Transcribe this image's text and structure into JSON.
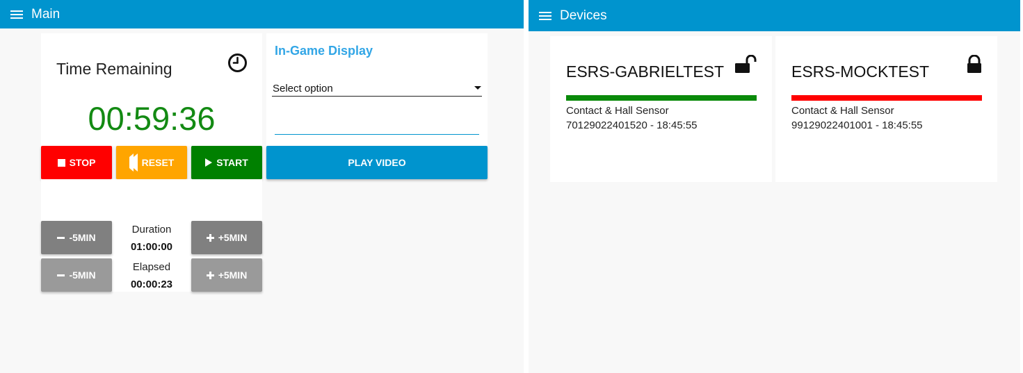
{
  "main": {
    "title": "Main",
    "time_card": {
      "title": "Time Remaining",
      "value": "00:59:36"
    },
    "display_card": {
      "title": "In-Game Display",
      "select_value": "Select option",
      "input_value": ""
    },
    "buttons": {
      "stop": "STOP",
      "reset": "RESET",
      "start": "START",
      "play_video": "PLAY VIDEO",
      "duration_minus": "-5MIN",
      "duration_plus": "+5MIN",
      "elapsed_minus": "-5MIN",
      "elapsed_plus": "+5MIN"
    },
    "duration": {
      "label": "Duration",
      "value": "01:00:00"
    },
    "elapsed": {
      "label": "Elapsed",
      "value": "00:00:23"
    }
  },
  "devices": {
    "title": "Devices",
    "items": [
      {
        "name": "ESRS-GABRIELTEST",
        "sensor": "Contact & Hall Sensor",
        "id_time": "70129022401520 - 18:45:55",
        "status_color": "#0a8a0a",
        "lock_icon": "lock-open-icon"
      },
      {
        "name": "ESRS-MOCKTEST",
        "sensor": "Contact & Hall Sensor",
        "id_time": "99129022401001 - 18:45:55",
        "status_color": "#ff0000",
        "lock_icon": "lock-closed-icon"
      }
    ]
  },
  "colors": {
    "header": "#0094ce",
    "stop": "#ff0000",
    "reset": "#ffa500",
    "start": "#008000",
    "play": "#0094ce",
    "timer_text": "#138a13"
  }
}
